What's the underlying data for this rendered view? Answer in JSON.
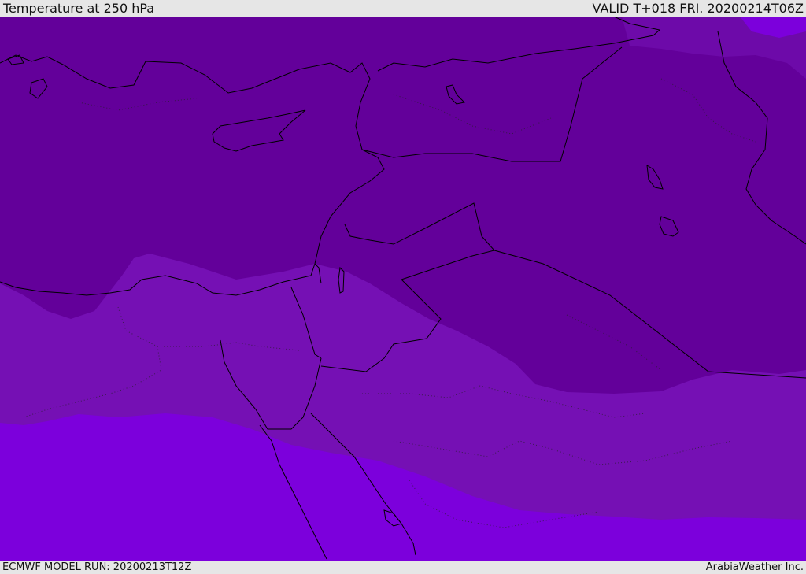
{
  "header": {
    "title": "Temperature at 250 hPa",
    "valid": "VALID T+018 FRI. 20200214T06Z"
  },
  "footer": {
    "model_run": "ECMWF MODEL RUN: 20200213T12Z",
    "credit": "ArabiaWeather Inc."
  },
  "map": {
    "field": "temperature",
    "level": "250 hPa",
    "colors": {
      "cold_band": "#63009a",
      "mid_band": "#7510b4",
      "warm_band": "#7c00dc",
      "coastline": "#000000",
      "border": "#000000"
    }
  }
}
